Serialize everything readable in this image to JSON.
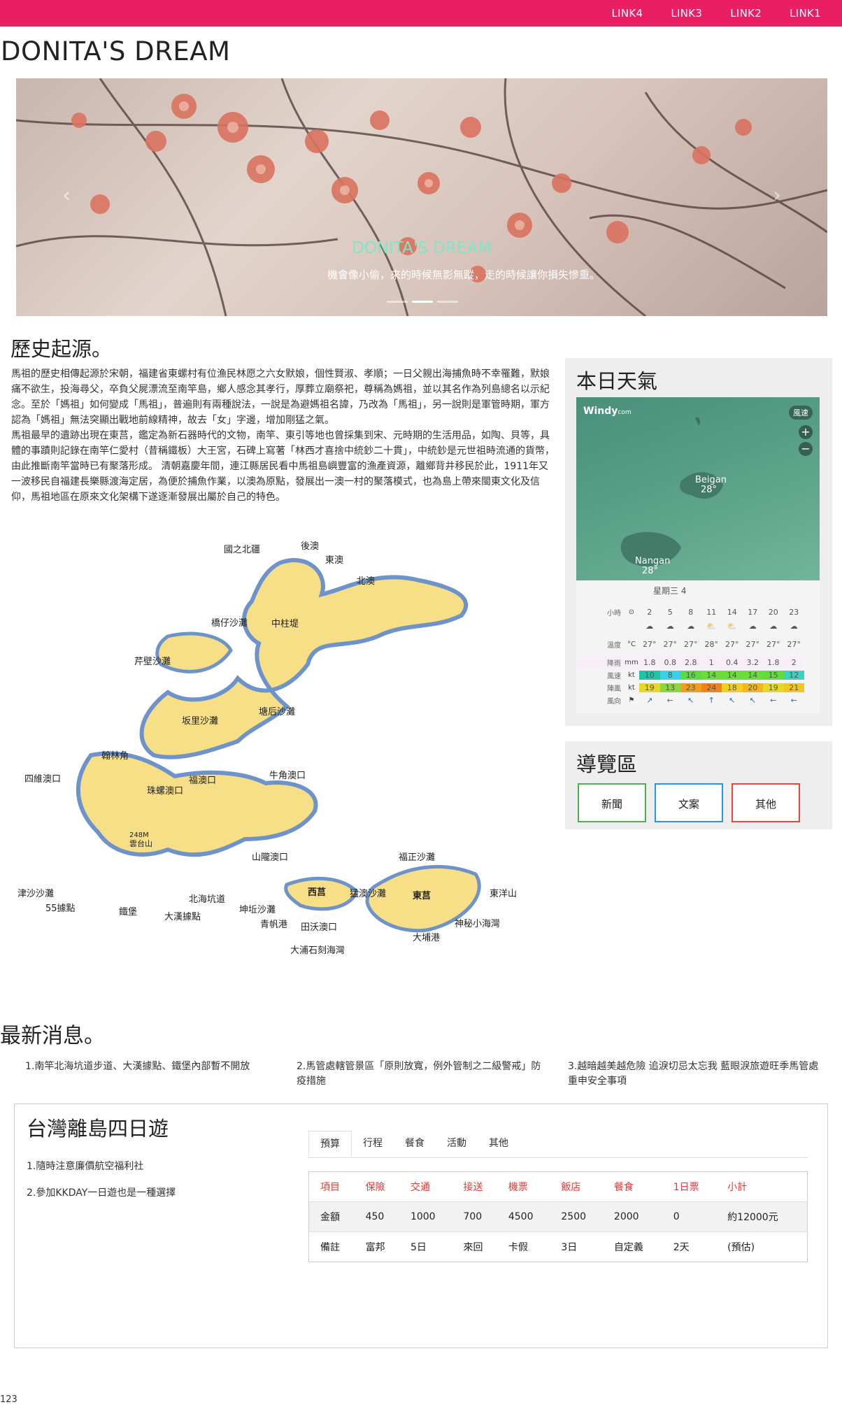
{
  "nav": {
    "links": [
      "LINK1",
      "LINK2",
      "LINK3",
      "LINK4"
    ]
  },
  "site": {
    "title": "DONITA'S DREAM"
  },
  "carousel": {
    "title": "DONITA'S DREAM",
    "caption": "機會像小偷，來的時候無影無蹤，走的時候讓你損失慘重。",
    "prev": "‹",
    "next": "›",
    "slide_count": 3,
    "active_slide": 2
  },
  "history": {
    "title": "歷史起源。",
    "paragraphs": [
      "馬祖的歷史相傳起源於宋朝，福建省東螺村有位漁民林愿之六女默娘，個性賢淑、孝順；一日父親出海捕魚時不幸罹難，默娘痛不欲生，投海尋父，卒負父屍漂流至南竿島，鄉人感念其孝行，厚葬立廟祭祀，尊稱為媽祖，並以其名作為列島總名以示紀念。至於「媽祖」如何變成「馬祖」，普遍則有兩種說法，一說是為避媽祖名諱，乃改為「馬祖」，另一說則是軍管時期，軍方認為「媽祖」無法突顯出戰地前線精神，故去「女」字邊，增加剛猛之氣。",
      "馬祖最早的遺跡出現在東莒，鑑定為新石器時代的文物，南竿、東引等地也曾採集到宋、元時期的生活用品，如陶、貝等，具體的事蹟則記錄在南竿仁愛村（昔稱鐵板）大王宮，石碑上寫著「林西才喜捨中統鈔二十貫」，中統鈔是元世祖時流通的貨幣，由此推斷南竿當時已有聚落形成。 清朝嘉慶年間，連江縣居民看中馬祖島嶼豐富的漁產資源，離鄉背井移民於此，1911年又一波移民自福建長樂縣渡海定居，為便於捕魚作業，以澳為原點，發展出一澳一村的聚落模式，也為島上帶來閩東文化及信仰，馬祖地區在原來文化架構下遂逐漸發展出屬於自己的特色。"
    ]
  },
  "map": {
    "north_labels": [
      "國之北疆",
      "後澳",
      "東澳",
      "北澳",
      "橋仔沙灘",
      "中柱堤",
      "芹壁沙灘",
      "坂里沙灘",
      "塘后沙灘"
    ],
    "south_labels": [
      "翰林角",
      "四維澳口",
      "福澳口",
      "牛角澳口",
      "珠螺澳口",
      "248M",
      "雲台山",
      "山隴澳口",
      "福正沙灘",
      "津沙沙灘",
      "55據點",
      "鐵堡",
      "大漢據點",
      "北海坑道",
      "坤坵沙灘",
      "青帆港",
      "田沃澳口",
      "猛澳沙灘",
      "東洋山",
      "西莒",
      "東莒",
      "神秘小海灣",
      "大埔港",
      "大浦石刻海灣"
    ]
  },
  "weather": {
    "title": "本日天氣",
    "windy": {
      "logo": "Windy",
      "logo_suffix": "com",
      "badge": "風速",
      "zoom_in": "+",
      "zoom_out": "−",
      "places": [
        {
          "name": "Beigan",
          "temp": "28°"
        },
        {
          "name": "Nangan",
          "temp": "28°"
        }
      ],
      "day_label": "星期三 4",
      "row_labels": {
        "hours": "小時",
        "temp": "溫度",
        "rain": "降雨",
        "wind": "風速",
        "gust": "陣風",
        "dir": "風向"
      },
      "units": {
        "temp": "°C",
        "rain": "mm",
        "wind": "kt",
        "gust": "kt"
      },
      "hours": [
        "2",
        "5",
        "8",
        "11",
        "14",
        "17",
        "20",
        "23"
      ],
      "temps": [
        "27°",
        "27°",
        "27°",
        "28°",
        "27°",
        "27°",
        "27°",
        "27°"
      ],
      "rain": [
        "1.8",
        "0.8",
        "2.8",
        "1",
        "0.4",
        "3.2",
        "1.8",
        "2"
      ],
      "wind": [
        "10",
        "8",
        "16",
        "14",
        "14",
        "14",
        "15",
        "12"
      ],
      "gust": [
        "19",
        "13",
        "23",
        "24",
        "18",
        "20",
        "19",
        "21"
      ],
      "wind_colors": [
        "#22c4a6",
        "#3ad1e4",
        "#5fd943",
        "#6cdc3c",
        "#6cdc3c",
        "#6cdc3c",
        "#63da3f",
        "#3fcfbd"
      ],
      "gust_colors": [
        "#e9d821",
        "#8cd83a",
        "#f59c1a",
        "#f3821c",
        "#efd021",
        "#f2b51c",
        "#e9d821",
        "#f0c71e"
      ],
      "wind_arrows": [
        "↗",
        "←",
        "↖",
        "↑",
        "↖",
        "↖",
        "←",
        "←"
      ]
    }
  },
  "guide": {
    "title": "導覽區",
    "buttons": [
      {
        "label": "新聞",
        "color": "#4caf50"
      },
      {
        "label": "文案",
        "color": "#2196f3"
      },
      {
        "label": "其他",
        "color": "#f44336"
      }
    ]
  },
  "news": {
    "title": "最新消息。",
    "items": [
      "1.南竿北海坑道步道、大漢據點、鐵堡內部暫不開放",
      "2.馬管處轄管景區「原則放寬，例外管制之二級警戒」防疫措施",
      "3.越暗越美越危險 追淚切忌太忘我 藍眼淚旅遊旺季馬管處重申安全事項"
    ]
  },
  "tour": {
    "title": "台灣離島四日遊",
    "tips": [
      "1.隨時注意廉價航空福利社",
      "2.參加KKDAY一日遊也是一種選擇"
    ],
    "tabs": [
      "預算",
      "行程",
      "餐食",
      "活動",
      "其他"
    ],
    "active_tab": 0,
    "table": {
      "headers": [
        "項目",
        "保險",
        "交通",
        "接送",
        "機票",
        "飯店",
        "餐食",
        "1日票",
        "小計"
      ],
      "rows": [
        [
          "金額",
          "450",
          "1000",
          "700",
          "4500",
          "2500",
          "2000",
          "0",
          "約12000元"
        ],
        [
          "備註",
          "富邦",
          "5日",
          "來回",
          "卡假",
          "3日",
          "自定義",
          "2天",
          "(預估)"
        ]
      ]
    }
  },
  "footer": {
    "text": "123"
  },
  "colors": {
    "accent": "#e91e63",
    "header_text": "#e53935"
  }
}
